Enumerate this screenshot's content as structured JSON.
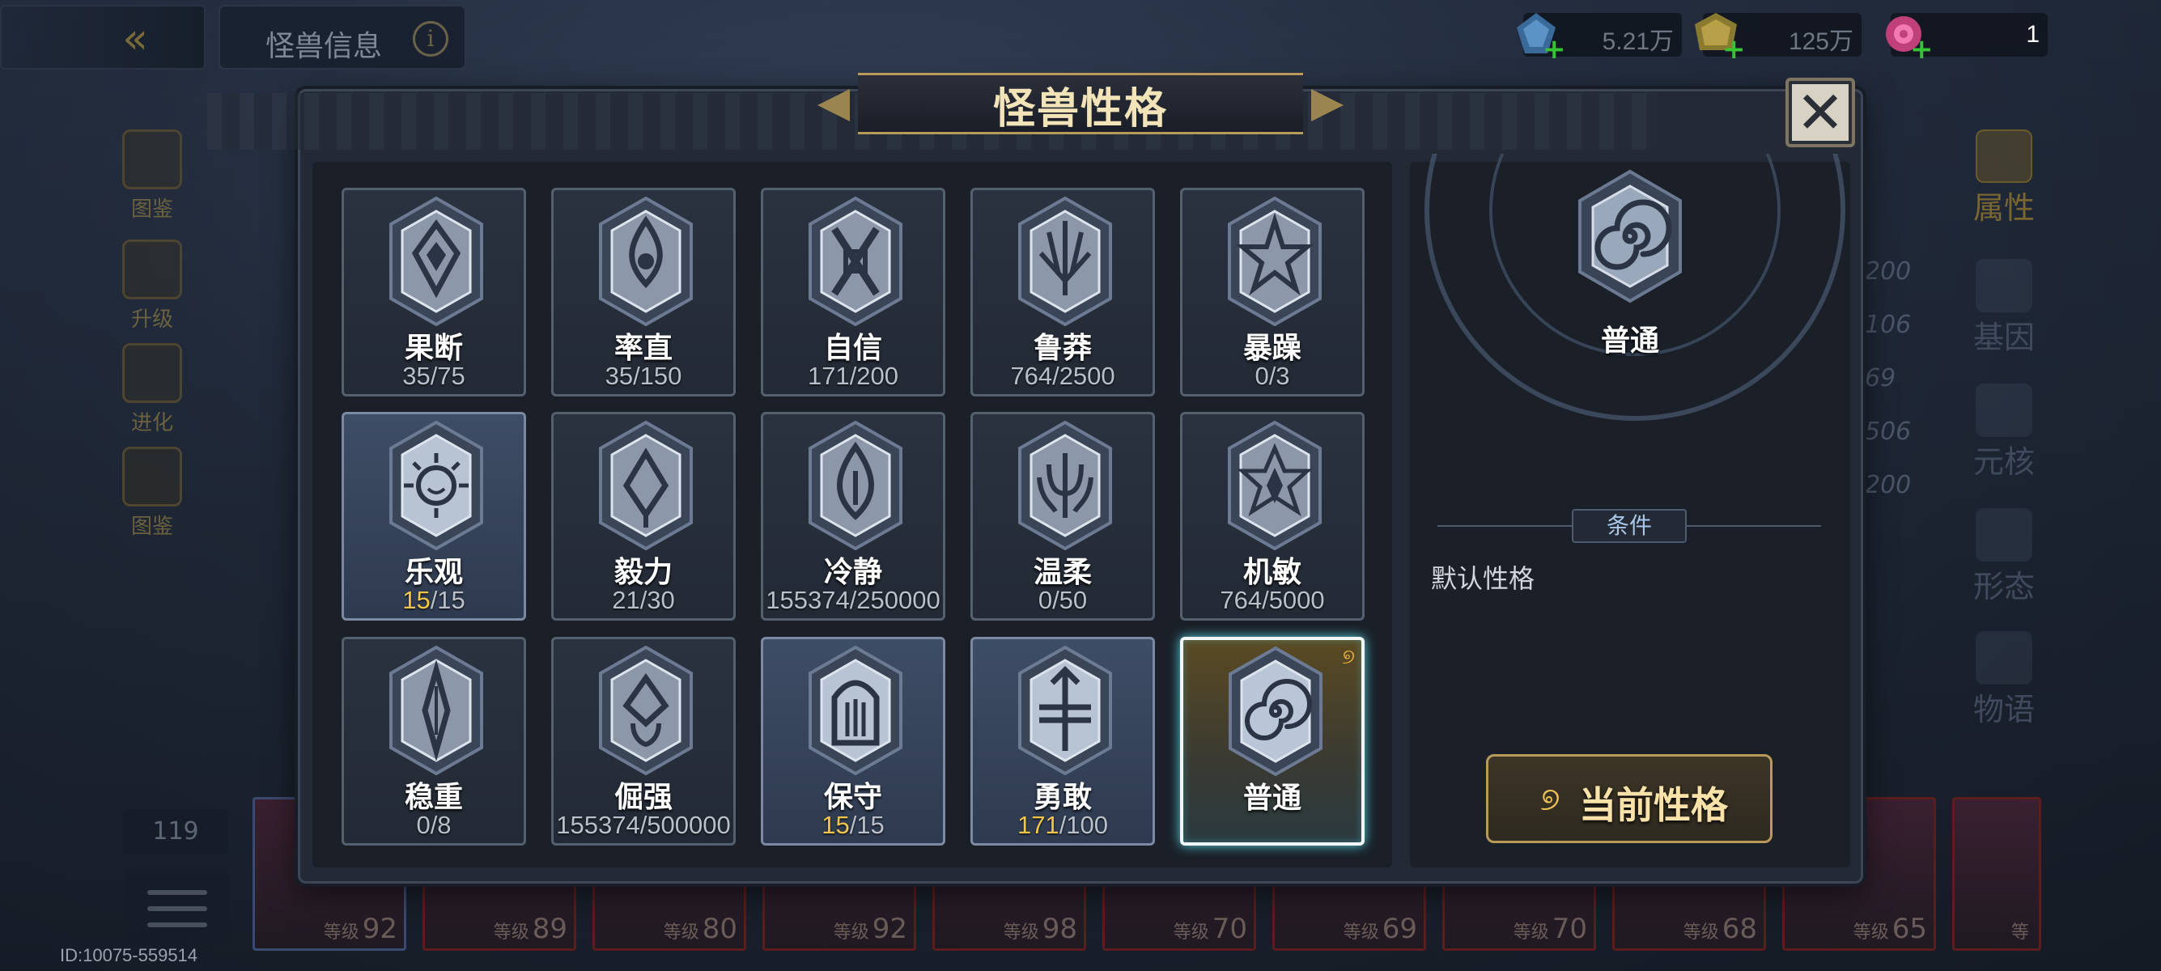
{
  "header": {
    "title": "怪兽信息",
    "info_glyph": "i",
    "back_glyph": "«"
  },
  "currencies": [
    {
      "icon": "blue-gem-icon",
      "value": "5.21万"
    },
    {
      "icon": "gold-coin-icon",
      "value": "125万"
    },
    {
      "icon": "pink-swirl-icon",
      "value": "1"
    }
  ],
  "sidebar_left": [
    {
      "label": "图鉴"
    },
    {
      "label": "升级"
    },
    {
      "label": "进化"
    },
    {
      "label": "图鉴"
    }
  ],
  "sidebar_right": [
    {
      "label": "属性"
    },
    {
      "label": "基因"
    },
    {
      "label": "元核"
    },
    {
      "label": "形态"
    },
    {
      "label": "物语"
    }
  ],
  "right_stats": [
    "200",
    "106",
    "69",
    "506",
    "200"
  ],
  "bottom": {
    "count": "119",
    "cards": [
      {
        "level_label": "等级",
        "level": "92"
      },
      {
        "level_label": "等级",
        "level": "89"
      },
      {
        "level_label": "等级",
        "level": "80"
      },
      {
        "level_label": "等级",
        "level": "92"
      },
      {
        "level_label": "等级",
        "level": "98"
      },
      {
        "level_label": "等级",
        "level": "70"
      },
      {
        "level_label": "等级",
        "level": "69"
      },
      {
        "level_label": "等级",
        "level": "70"
      },
      {
        "level_label": "等级",
        "level": "68"
      },
      {
        "level_label": "等级",
        "level": "65"
      },
      {
        "level_label": "等",
        "level": ""
      }
    ],
    "id_text": "ID:10075-559514"
  },
  "modal": {
    "title": "怪兽性格",
    "close_glyph": "✕",
    "traits": [
      {
        "name": "果断",
        "cur": "35",
        "max": "/75",
        "full": false,
        "icon": "diamond-crest-icon"
      },
      {
        "name": "率直",
        "cur": "35",
        "max": "/150",
        "full": false,
        "icon": "flame-drop-icon"
      },
      {
        "name": "自信",
        "cur": "171",
        "max": "/200",
        "full": false,
        "icon": "cross-knot-icon"
      },
      {
        "name": "鲁莽",
        "cur": "764",
        "max": "/2500",
        "full": false,
        "icon": "claw-icon"
      },
      {
        "name": "暴躁",
        "cur": "0",
        "max": "/3",
        "full": false,
        "icon": "burst-star-icon"
      },
      {
        "name": "乐观",
        "cur": "15",
        "max": "/15",
        "full": true,
        "icon": "smiling-sun-icon"
      },
      {
        "name": "毅力",
        "cur": "21",
        "max": "/30",
        "full": false,
        "icon": "diamond-sprout-icon"
      },
      {
        "name": "冷静",
        "cur": "155374",
        "max": "/250000",
        "full": false,
        "icon": "water-drop-icon"
      },
      {
        "name": "温柔",
        "cur": "0",
        "max": "/50",
        "full": false,
        "icon": "fountain-icon"
      },
      {
        "name": "机敏",
        "cur": "764",
        "max": "/5000",
        "full": false,
        "icon": "hex-star-icon"
      },
      {
        "name": "稳重",
        "cur": "0",
        "max": "/8",
        "full": false,
        "icon": "spike-icon"
      },
      {
        "name": "倔强",
        "cur": "155374",
        "max": "/500000",
        "full": false,
        "icon": "heart-drop-icon"
      },
      {
        "name": "保守",
        "cur": "15",
        "max": "/15",
        "full": true,
        "icon": "helmet-icon"
      },
      {
        "name": "勇敢",
        "cur": "171",
        "max": "/100",
        "full": true,
        "icon": "arrow-shield-icon"
      },
      {
        "name": "普通",
        "cur": "",
        "max": "",
        "full": false,
        "icon": "spiral-icon",
        "current": true
      }
    ],
    "detail": {
      "name": "普通",
      "icon": "spiral-icon",
      "condition_label": "条件",
      "condition_text": "默认性格",
      "current_button": "当前性格"
    }
  },
  "colors": {
    "accent_gold": "#b99a5a",
    "highlight_yellow": "#f2c64a",
    "active_glow": "#5ad6e0"
  }
}
